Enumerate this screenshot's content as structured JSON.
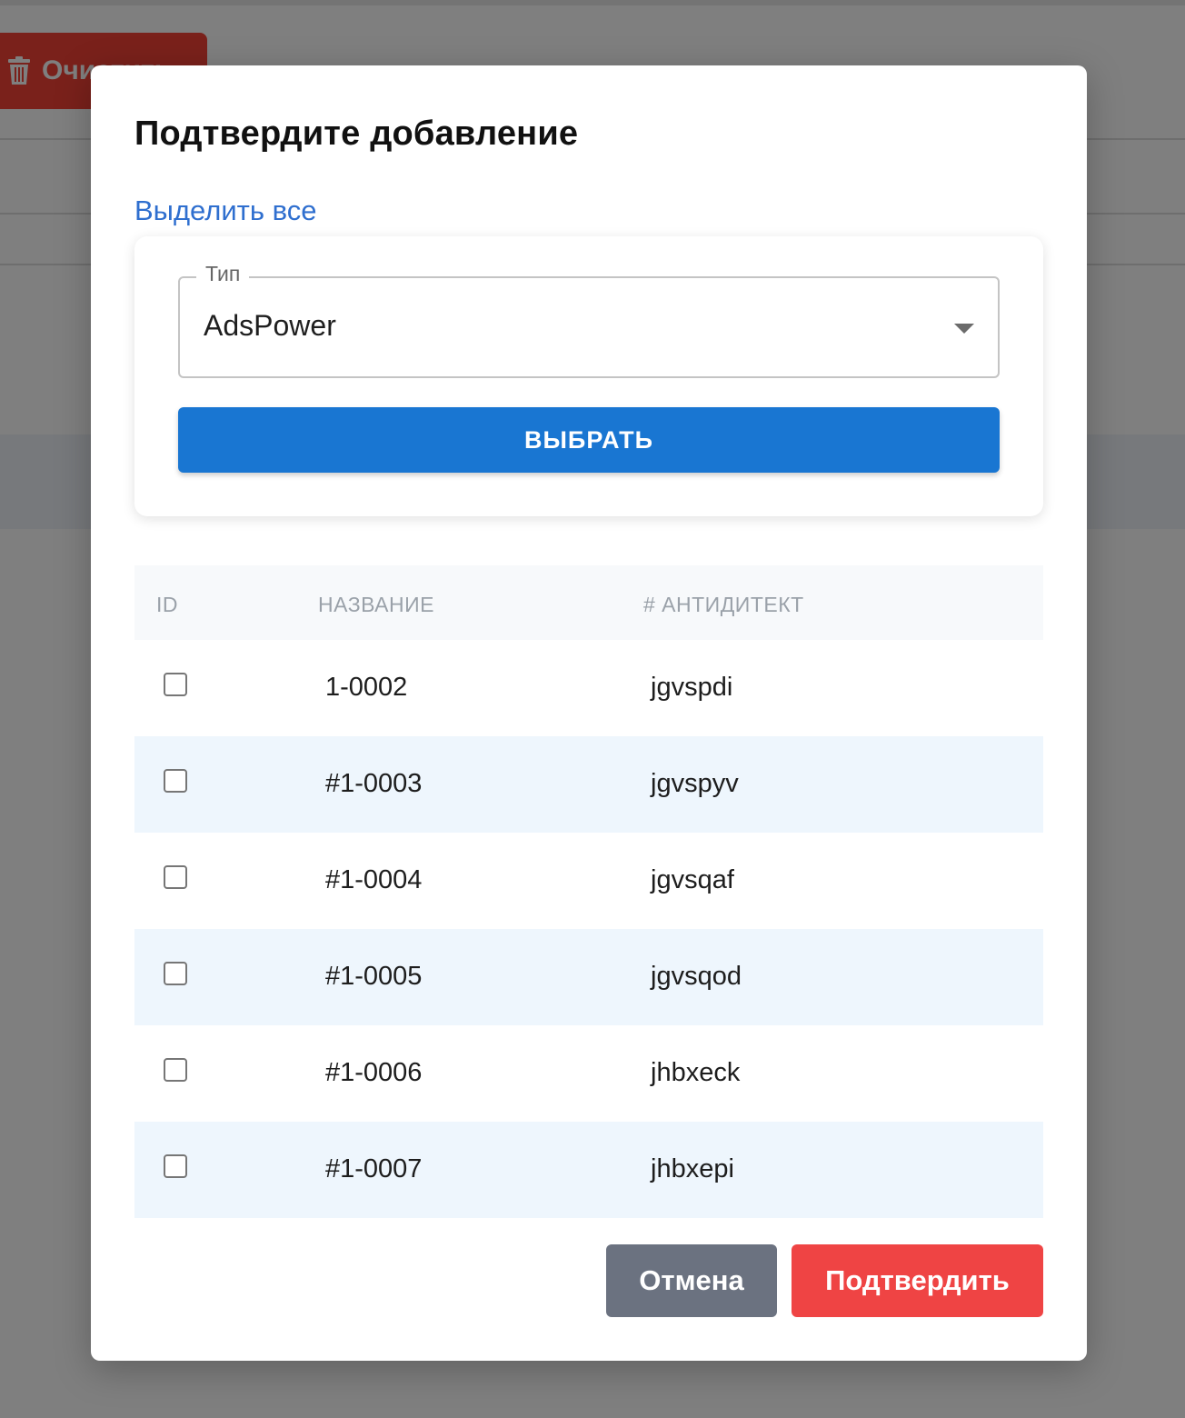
{
  "background": {
    "clear_button_label": "Очистить",
    "clear_icon": "trash-icon"
  },
  "modal": {
    "title": "Подтвердите добавление",
    "select_all_label": "Выделить все",
    "type_field": {
      "label": "Тип",
      "value": "AdsPower",
      "icon": "chevron-down-icon"
    },
    "choose_button_label": "ВЫБРАТЬ",
    "table": {
      "columns": [
        "ID",
        "НАЗВАНИЕ",
        "# АНТИДИТЕКТ"
      ],
      "rows": [
        {
          "checked": false,
          "name": "1-0002",
          "antidetect": "jgvspdi"
        },
        {
          "checked": false,
          "name": "#1-0003",
          "antidetect": "jgvspyv"
        },
        {
          "checked": false,
          "name": "#1-0004",
          "antidetect": "jgvsqaf"
        },
        {
          "checked": false,
          "name": "#1-0005",
          "antidetect": "jgvsqod"
        },
        {
          "checked": false,
          "name": "#1-0006",
          "antidetect": "jhbxeck"
        },
        {
          "checked": false,
          "name": "#1-0007",
          "antidetect": "jhbxepi"
        }
      ]
    },
    "cancel_label": "Отмена",
    "confirm_label": "Подтвердить"
  },
  "colors": {
    "primary": "#1976d2",
    "link": "#2f6fcf",
    "cancel": "#6b7280",
    "confirm": "#ef4444",
    "row_alt": "#eef6fd"
  }
}
